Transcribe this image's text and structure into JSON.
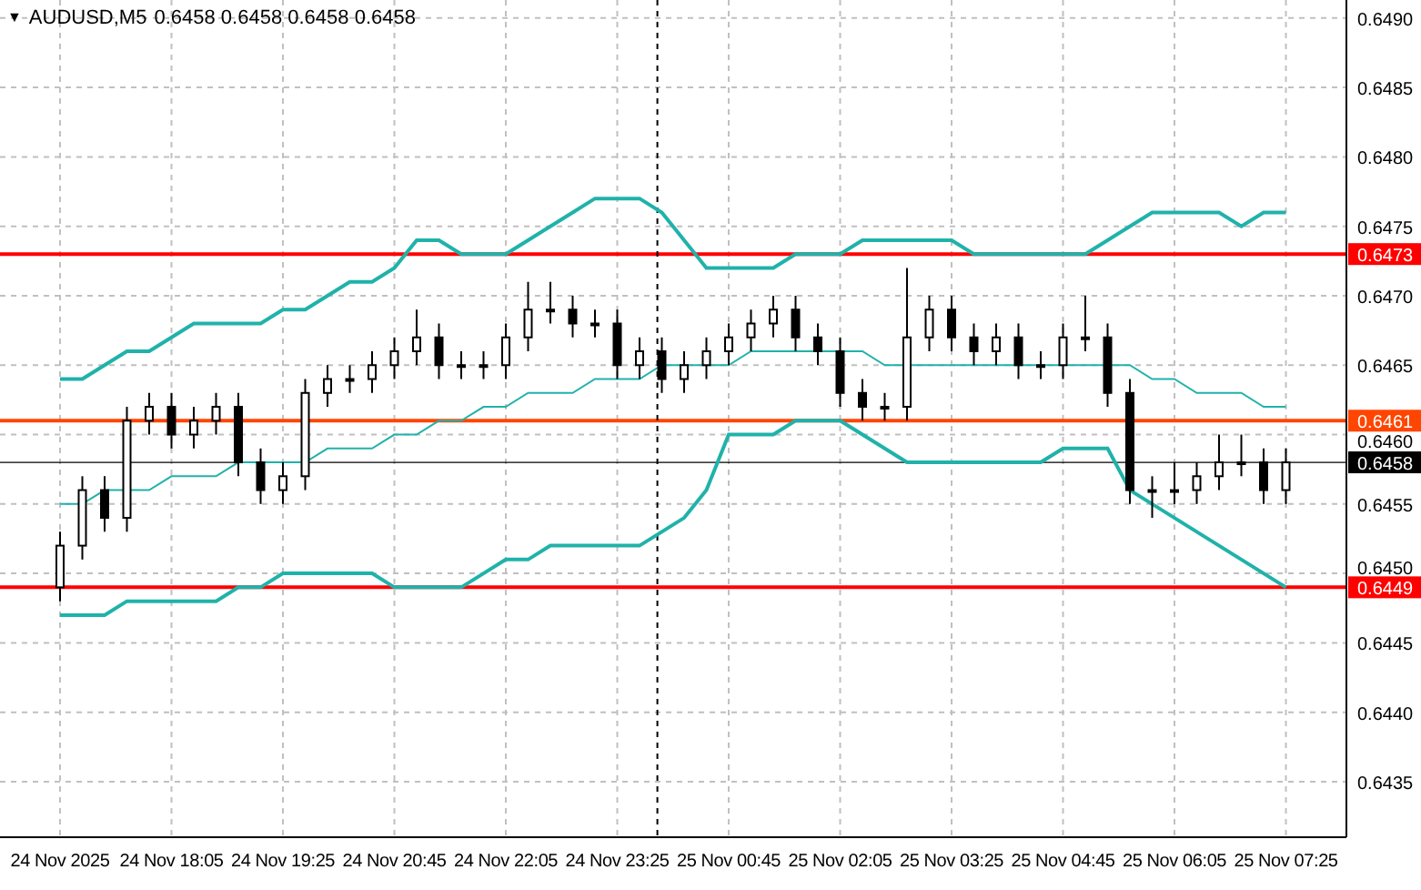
{
  "header": {
    "menu_glyph": "▼",
    "symbol": "AUDUSD,M5",
    "quote": "0.6458 0.6458 0.6458 0.6458"
  },
  "chart_data": {
    "type": "candlestick",
    "categories": [
      "24 Nov 2025",
      null,
      null,
      null,
      null,
      "24 Nov 18:05",
      null,
      null,
      null,
      null,
      "24 Nov 19:25",
      null,
      null,
      null,
      null,
      "24 Nov 20:45",
      null,
      null,
      null,
      null,
      "24 Nov 22:05",
      null,
      null,
      null,
      null,
      "24 Nov 23:25",
      null,
      null,
      null,
      null,
      "25 Nov 00:45",
      null,
      null,
      null,
      null,
      "25 Nov 02:05",
      null,
      null,
      null,
      null,
      "25 Nov 03:25",
      null,
      null,
      null,
      null,
      "25 Nov 04:45",
      null,
      null,
      null,
      null,
      "25 Nov 06:05",
      null,
      null,
      null,
      null,
      "25 Nov 07:25"
    ],
    "ohlc": [
      [
        0.6449,
        0.6453,
        0.6448,
        0.6452
      ],
      [
        0.6452,
        0.6457,
        0.6451,
        0.6456
      ],
      [
        0.6456,
        0.6457,
        0.6453,
        0.6454
      ],
      [
        0.6454,
        0.6462,
        0.6453,
        0.6461
      ],
      [
        0.6461,
        0.6463,
        0.646,
        0.6462
      ],
      [
        0.6462,
        0.6463,
        0.6459,
        0.646
      ],
      [
        0.646,
        0.6462,
        0.6459,
        0.6461
      ],
      [
        0.6461,
        0.6463,
        0.646,
        0.6462
      ],
      [
        0.6462,
        0.6463,
        0.6457,
        0.6458
      ],
      [
        0.6458,
        0.6459,
        0.6455,
        0.6456
      ],
      [
        0.6456,
        0.6458,
        0.6455,
        0.6457
      ],
      [
        0.6457,
        0.6464,
        0.6456,
        0.6463
      ],
      [
        0.6463,
        0.6465,
        0.6462,
        0.6464
      ],
      [
        0.6464,
        0.6465,
        0.6463,
        0.6464
      ],
      [
        0.6464,
        0.6466,
        0.6463,
        0.6465
      ],
      [
        0.6465,
        0.6467,
        0.6464,
        0.6466
      ],
      [
        0.6466,
        0.6469,
        0.6465,
        0.6467
      ],
      [
        0.6467,
        0.6468,
        0.6464,
        0.6465
      ],
      [
        0.6465,
        0.6466,
        0.6464,
        0.6465
      ],
      [
        0.6465,
        0.6466,
        0.6464,
        0.6465
      ],
      [
        0.6465,
        0.6468,
        0.6464,
        0.6467
      ],
      [
        0.6467,
        0.6471,
        0.6466,
        0.6469
      ],
      [
        0.6469,
        0.6471,
        0.6468,
        0.6469
      ],
      [
        0.6469,
        0.647,
        0.6467,
        0.6468
      ],
      [
        0.6468,
        0.6469,
        0.6467,
        0.6468
      ],
      [
        0.6468,
        0.6469,
        0.6464,
        0.6465
      ],
      [
        0.6465,
        0.6467,
        0.6464,
        0.6466
      ],
      [
        0.6466,
        0.6467,
        0.6463,
        0.6464
      ],
      [
        0.6464,
        0.6466,
        0.6463,
        0.6465
      ],
      [
        0.6465,
        0.6467,
        0.6464,
        0.6466
      ],
      [
        0.6466,
        0.6468,
        0.6465,
        0.6467
      ],
      [
        0.6467,
        0.6469,
        0.6466,
        0.6468
      ],
      [
        0.6468,
        0.647,
        0.6467,
        0.6469
      ],
      [
        0.6469,
        0.647,
        0.6466,
        0.6467
      ],
      [
        0.6467,
        0.6468,
        0.6465,
        0.6466
      ],
      [
        0.6466,
        0.6467,
        0.6462,
        0.6463
      ],
      [
        0.6463,
        0.6464,
        0.6461,
        0.6462
      ],
      [
        0.6462,
        0.6463,
        0.6461,
        0.6462
      ],
      [
        0.6462,
        0.6472,
        0.6461,
        0.6467
      ],
      [
        0.6467,
        0.647,
        0.6466,
        0.6469
      ],
      [
        0.6469,
        0.647,
        0.6466,
        0.6467
      ],
      [
        0.6467,
        0.6468,
        0.6465,
        0.6466
      ],
      [
        0.6466,
        0.6468,
        0.6465,
        0.6467
      ],
      [
        0.6467,
        0.6468,
        0.6464,
        0.6465
      ],
      [
        0.6465,
        0.6466,
        0.6464,
        0.6465
      ],
      [
        0.6465,
        0.6468,
        0.6464,
        0.6467
      ],
      [
        0.6467,
        0.647,
        0.6466,
        0.6467
      ],
      [
        0.6467,
        0.6468,
        0.6462,
        0.6463
      ],
      [
        0.6463,
        0.6464,
        0.6455,
        0.6456
      ],
      [
        0.6456,
        0.6457,
        0.6454,
        0.6456
      ],
      [
        0.6456,
        0.6458,
        0.6455,
        0.6456
      ],
      [
        0.6456,
        0.6458,
        0.6455,
        0.6457
      ],
      [
        0.6457,
        0.646,
        0.6456,
        0.6458
      ],
      [
        0.6458,
        0.646,
        0.6457,
        0.6458
      ],
      [
        0.6458,
        0.6459,
        0.6455,
        0.6456
      ],
      [
        0.6456,
        0.6459,
        0.6455,
        0.6458
      ]
    ],
    "series": [
      {
        "type": "line",
        "color": "#20b2aa",
        "values": [
          0.6464,
          0.6464,
          0.6465,
          0.6466,
          0.6466,
          0.6467,
          0.6468,
          0.6468,
          0.6468,
          0.6468,
          0.6469,
          0.6469,
          0.647,
          0.6471,
          0.6471,
          0.6472,
          0.6474,
          0.6474,
          0.6473,
          0.6473,
          0.6473,
          0.6474,
          0.6475,
          0.6476,
          0.6477,
          0.6477,
          0.6477,
          0.6476,
          0.6474,
          0.6472,
          0.6472,
          0.6472,
          0.6472,
          0.6473,
          0.6473,
          0.6473,
          0.6474,
          0.6474,
          0.6474,
          0.6474,
          0.6474,
          0.6473,
          0.6473,
          0.6473,
          0.6473,
          0.6473,
          0.6473,
          0.6474,
          0.6475,
          0.6476,
          0.6476,
          0.6476,
          0.6476,
          0.6475,
          0.6476,
          0.6476
        ]
      },
      {
        "type": "line",
        "color": "#20b2aa",
        "values": [
          0.6455,
          0.6455,
          0.6456,
          0.6456,
          0.6456,
          0.6457,
          0.6457,
          0.6457,
          0.6458,
          0.6458,
          0.6458,
          0.6458,
          0.6459,
          0.6459,
          0.6459,
          0.646,
          0.646,
          0.6461,
          0.6461,
          0.6462,
          0.6462,
          0.6463,
          0.6463,
          0.6463,
          0.6464,
          0.6464,
          0.6464,
          0.6465,
          0.6465,
          0.6465,
          0.6465,
          0.6466,
          0.6466,
          0.6466,
          0.6466,
          0.6466,
          0.6466,
          0.6465,
          0.6465,
          0.6465,
          0.6465,
          0.6465,
          0.6465,
          0.6465,
          0.6465,
          0.6465,
          0.6465,
          0.6465,
          0.6465,
          0.6464,
          0.6464,
          0.6463,
          0.6463,
          0.6463,
          0.6462,
          0.6462
        ]
      },
      {
        "type": "line",
        "color": "#20b2aa",
        "values": [
          0.6447,
          0.6447,
          0.6447,
          0.6448,
          0.6448,
          0.6448,
          0.6448,
          0.6448,
          0.6449,
          0.6449,
          0.645,
          0.645,
          0.645,
          0.645,
          0.645,
          0.6449,
          0.6449,
          0.6449,
          0.6449,
          0.645,
          0.6451,
          0.6451,
          0.6452,
          0.6452,
          0.6452,
          0.6452,
          0.6452,
          0.6453,
          0.6454,
          0.6456,
          0.646,
          0.646,
          0.646,
          0.6461,
          0.6461,
          0.6461,
          0.646,
          0.6459,
          0.6458,
          0.6458,
          0.6458,
          0.6458,
          0.6458,
          0.6458,
          0.6458,
          0.6459,
          0.6459,
          0.6459,
          0.6456,
          0.6455,
          0.6454,
          0.6453,
          0.6452,
          0.6451,
          0.645,
          0.6449
        ]
      }
    ],
    "ylim": [
      0.6431,
      0.64913
    ],
    "yticks": [
      {
        "value": 0.649,
        "label": "0.6490"
      },
      {
        "value": 0.6485,
        "label": "0.6485"
      },
      {
        "value": 0.648,
        "label": "0.6480"
      },
      {
        "value": 0.6475,
        "label": "0.6475"
      },
      {
        "value": 0.647,
        "label": "0.6470"
      },
      {
        "value": 0.6465,
        "label": "0.6465"
      },
      {
        "value": 0.646,
        "label": "0.6460"
      },
      {
        "value": 0.6455,
        "label": "0.6455"
      },
      {
        "value": 0.645,
        "label": "0.6450"
      },
      {
        "value": 0.6445,
        "label": "0.6445"
      },
      {
        "value": 0.644,
        "label": "0.6440"
      },
      {
        "value": 0.6435,
        "label": "0.6435"
      }
    ],
    "grid": true,
    "ref_lines": [
      {
        "axis": "y",
        "value": 0.6473,
        "label": "0.6473",
        "color": "#ff0000"
      },
      {
        "axis": "y",
        "value": 0.6461,
        "label": "0.6461",
        "color": "#ff4500"
      },
      {
        "axis": "y",
        "value": 0.6458,
        "label": "0.6458",
        "color": "#000000"
      },
      {
        "axis": "y",
        "value": 0.6449,
        "label": "0.6449",
        "color": "#ff0000"
      }
    ]
  }
}
